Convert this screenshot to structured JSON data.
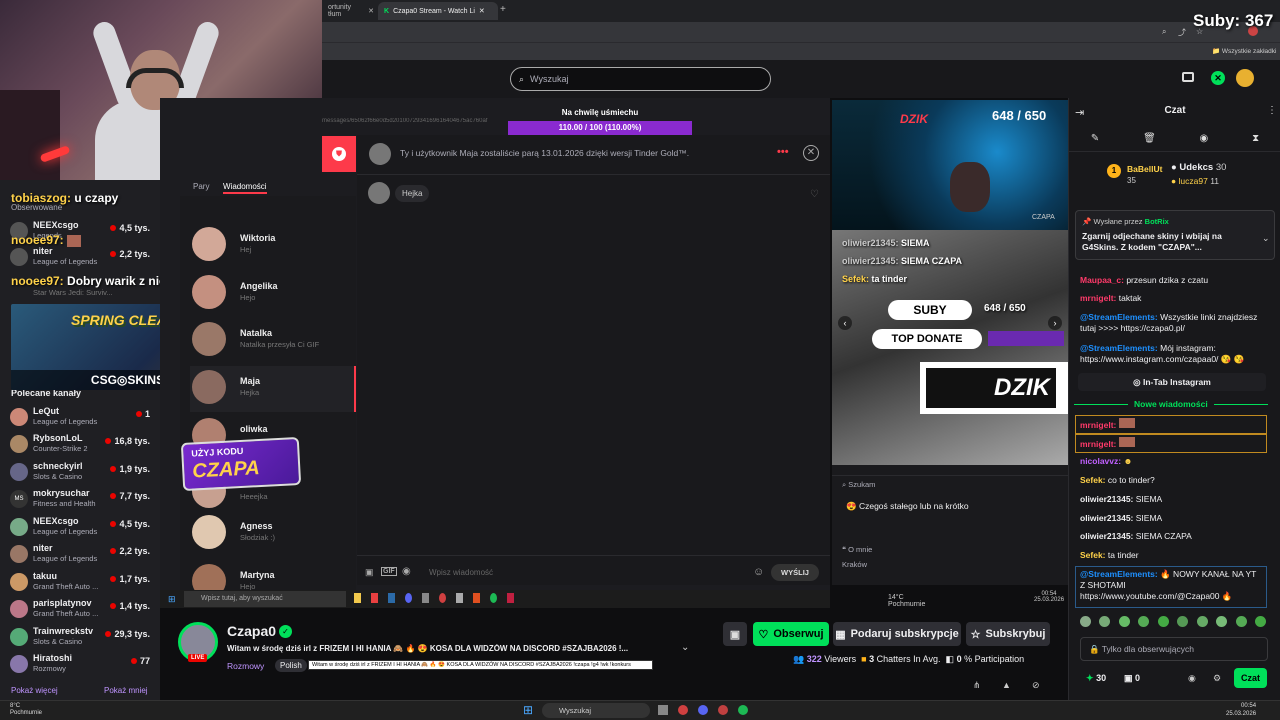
{
  "browser": {
    "tabs": [
      {
        "label": "ortunity tłum"
      },
      {
        "label": "Czapa0 Stream - Watch Li"
      }
    ],
    "bookmarks_label": "Wszystkie zakładki"
  },
  "overlay": {
    "subs_label": "Suby: 367",
    "chat_lines": [
      {
        "user": "tobiaszog:",
        "text": "u czapy"
      },
      {
        "user": "nooee97:",
        "text": ""
      },
      {
        "user": "nooee97:",
        "text": "Dobry warik z niego 🤣 🤣 🤣"
      }
    ],
    "spring_cleanup": "SPRING CLEANUP",
    "csgo_skins": "CSG◎SKINS",
    "uzyj_kodu": "UŻYJ KODU",
    "czapa_code": "CZAPA",
    "na_chwile": "Na chwilę uśmiechu",
    "progress_text": "110.00 / 100 (110.00%)",
    "progress_value": 1.1,
    "subs_bar": "648 / 650",
    "subs_bar_top": "648 / 650",
    "suby_label": "SUBY",
    "top_donate": "TOP DONATE",
    "dzik": "DZIK",
    "czapa_cam_label": "CZAPA",
    "cam_chat": [
      {
        "user": "oliwier21345:",
        "text": "SIEMA"
      },
      {
        "user": "oliwier21345:",
        "text": "SIEMA CZAPA"
      },
      {
        "user": "Sefek:",
        "text": "ta tinder"
      }
    ],
    "szukam": "Szukam",
    "czegos": "Czegoś stałego lub na krótko",
    "o_mnie": "O mnie",
    "krakow": "Kraków"
  },
  "header": {
    "search_placeholder": "Wyszukaj"
  },
  "sidebar": {
    "top_channels": [
      {
        "name": "NEEXcsgo",
        "category": "Legends",
        "viewers": "4,5 tys."
      },
      {
        "name": "niter",
        "category": "League of Legends",
        "viewers": "2,2 tys."
      },
      {
        "name": "",
        "category": "Star Wars Jedi: Surviv...",
        "viewers": ""
      }
    ],
    "observed_label": "Obserwowane",
    "recommended_title": "Polecane kanały",
    "channels": [
      {
        "name": "LeQut",
        "category": "League of Legends",
        "viewers": "1"
      },
      {
        "name": "RybsonLoL",
        "category": "Counter-Strike 2",
        "viewers": "16,8 tys."
      },
      {
        "name": "schneckyirl",
        "category": "Slots & Casino",
        "viewers": "1,9 tys."
      },
      {
        "name": "mokrysuchar",
        "category": "Fitness and Health",
        "viewers": "7,7 tys."
      },
      {
        "name": "NEEXcsgo",
        "category": "League of Legends",
        "viewers": "4,5 tys."
      },
      {
        "name": "niter",
        "category": "League of Legends",
        "viewers": "2,2 tys."
      },
      {
        "name": "takuu",
        "category": "Grand Theft Auto ...",
        "viewers": "1,7 tys."
      },
      {
        "name": "parisplatynov",
        "category": "Grand Theft Auto ...",
        "viewers": "1,4 tys."
      },
      {
        "name": "Trainwreckstv",
        "category": "Slots & Casino",
        "viewers": "29,3 tys."
      },
      {
        "name": "Hiratoshi",
        "category": "Rozmowy",
        "viewers": "77"
      }
    ],
    "show_more": "Pokaż więcej",
    "show_less": "Pokaż mniej"
  },
  "dating_app": {
    "tabs": [
      "Pary",
      "Wiadomości"
    ],
    "conversations": [
      {
        "name": "Wiktoria",
        "preview": "Hej"
      },
      {
        "name": "Angelika",
        "preview": "Hejo"
      },
      {
        "name": "Natalka",
        "preview": "Natalka przesyła Ci GIF"
      },
      {
        "name": "Maja",
        "preview": "Hejka"
      },
      {
        "name": "oliwka",
        "preview": ""
      },
      {
        "name": "",
        "preview": "Heeejka"
      },
      {
        "name": "Agness",
        "preview": "Słodziak :)"
      },
      {
        "name": "Martyna",
        "preview": "Hejo"
      }
    ],
    "match_notice": "Ty i użytkownik Maja zostaliście parą 13.01.2026 dzięki wersji Tinder Gold™.",
    "message_bubble": "Hejka",
    "message_placeholder": "Wpisz wiadomość",
    "send_button": "WYŚLIJ",
    "gif_label": "GIF",
    "url_fragment": "messages/65062f66e0d5d2010072934169616404675ac760af",
    "inner_taskbar_search": "Wpisz tutaj, aby wyszukać",
    "inner_weather": "14°C  Pochmurnie",
    "inner_time": "00:54",
    "inner_date": "25.03.2026"
  },
  "stream_info": {
    "channel_name": "Czapa0",
    "live_badge": "LIVE",
    "title": "Witam w środę dziś irl z FRIZEM I HI HANIA 🙈 🔥 😍 KOSA DLA WIDZÓW NA DISCORD #SZAJBA2026 !...",
    "tooltip": "Witam w środę dziś irl z FRIZEM I HI HANIA 🙈 🔥 😍 KOSA DLA WIDZÓW NA DISCORD #SZAJBA2026 !czapa !g4 !wk !konkurs",
    "category": "Rozmowy",
    "tag": "Polish",
    "follow_button": "Obserwuj",
    "gift_button": "Podaruj subskrypcje",
    "subscribe_button": "Subskrybuj",
    "viewers_count": "322",
    "viewers_label": "Viewers",
    "chatters_count": "3",
    "chatters_label": "Chatters In Avg.",
    "participation_count": "0",
    "participation_label": "% Participation"
  },
  "chat": {
    "title": "Czat",
    "leaderboard": [
      {
        "rank": "1",
        "name": "BaBellUt",
        "value": "35"
      },
      {
        "name": "Udekcs",
        "value": "30"
      },
      {
        "name": "lucza97",
        "value": "11"
      }
    ],
    "pinned_by_label": "Wysłane przez",
    "pinned_by_user": "BotRix",
    "pinned_text": "Zgarnij odjechane skiny i wbijaj na G4Skins. Z kodem \"CZAPA\"...",
    "messages": [
      {
        "user": "Maupaa_c:",
        "text": "przesun dzika z czatu"
      },
      {
        "user": "mrnigelt:",
        "text": "taktak"
      },
      {
        "user": "@StreamElements:",
        "text": "Wszystkie linki znajdziesz tutaj >>>> https://czapa0.pl/"
      },
      {
        "user": "@StreamElements:",
        "text": "Mój instagram: https://www.instagram.com/czapaa0/ 😘 😘"
      }
    ],
    "instagram_button": "In-Tab Instagram",
    "new_messages_label": "Nowe wiadomości",
    "new_messages": [
      {
        "user": "mrnigelt:",
        "text": ""
      },
      {
        "user": "mrnigelt:",
        "text": ""
      },
      {
        "user": "nicolavvz:",
        "text": ""
      },
      {
        "user": "Sefek:",
        "text": "co to tinder?"
      },
      {
        "user": "oliwier21345:",
        "text": "SIEMA"
      },
      {
        "user": "oliwier21345:",
        "text": "SIEMA"
      },
      {
        "user": "oliwier21345:",
        "text": "SIEMA CZAPA"
      },
      {
        "user": "Sefek:",
        "text": "ta tinder"
      },
      {
        "user": "@StreamElements:",
        "text": "🔥 NOWY KANAŁ NA YT Z SHOTAMI https://www.youtube.com/@Czapa00 🔥"
      }
    ],
    "input_placeholder": "Tylko dla obserwujących",
    "points": "30",
    "bits": "0",
    "send_button": "Czat"
  },
  "taskbar": {
    "weather_temp": "8°C",
    "weather_desc": "Pochmurnie",
    "search_placeholder": "Wyszukaj",
    "time": "00:54",
    "date": "25.03.2026"
  },
  "colors": {
    "twitch_purple": "#9147ff",
    "follow_green": "#00e05a",
    "live_red": "#eb0400",
    "tinder_red": "#fd3a4a"
  }
}
